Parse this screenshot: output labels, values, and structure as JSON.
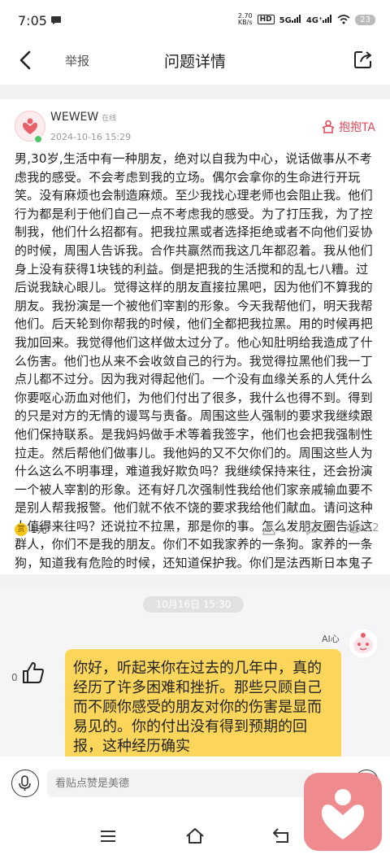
{
  "status": {
    "time": "7:05",
    "speed_value": "2.70",
    "speed_unit": "KB/s",
    "hd": "HD",
    "net1": "5G",
    "net2": "4G⁺",
    "battery": "23"
  },
  "nav": {
    "report": "举报",
    "title": "问题详情"
  },
  "post": {
    "username": "WEWEW",
    "online": "在线",
    "date": "2024-10-16 15:29",
    "hug_label": "抱抱TA",
    "body": "男,30岁,生活中有一种朋友，绝对以自我为中心，说话做事从不考虑我的感受。不会考虑到我的立场。偶尔会拿你的生命进行开玩笑。没有麻烦也会制造麻烦。至少我找心理老师也会阻止我。他们行为都是利于他们自己一点不考虑我的感受。为了打压我，为了控制我，他们什么招都有。把我拉黑或者选择拒绝或者不向他们妥协的时候，周围人告诉我。合作共赢然而我这几年都忍着。我从他们身上没有获得1块钱的利益。倒是把我的生活搅和的乱七八糟。过后说我缺心眼儿。觉得这样的朋友直接拉黑吧，因为他们不算我的朋友。我扮演是一个被他们宰割的形象。今天我帮他们，明天我帮他们。后天轮到你帮我的时候，他们全都把我拉黑。用的时候再把我加回来。我觉得他们这样做太过分了。他心知肚明给我造成了什么伤害。他们也从来不会收敛自己的行为。我觉得拉黑他们我一丁点儿都不过分。因为我对得起他们。一个没有血缘关系的人凭什么你要呕心沥血对他们，为他们付出了很多，我什么也得不到。得到的只是对方的无情的谩骂与责备。周围这些人强制的要求我继续跟他们保持联系。是我妈妈做手术等着我签字，他们也会把我强制性拉走。然后帮他们做事儿。我他妈的又不欠你们的。周围这些人为什么这么不明事理，难道我好欺负吗？我继续保持来往，还会扮演一个被人宰割的形象。还有好几次强制性我给他们家亲戚输血要不是别人帮我报警。他们就不依不饶的要求我给他们献血。请问这种人值得来往吗？还说拉不拉黑，那是你的事。怎么发朋友圈告诉这群人，你们不是我的朋友。你们不如我家养的一条狗。家养的一条狗，知道我有危险的时候，还知道保护我。你们是法西斯日本鬼子转世吗？",
    "reward_icon": "赏",
    "reward": "1元",
    "hugs": "1",
    "comments": "2",
    "views": "52"
  },
  "chat": {
    "timestamp": "10月16日 15:30",
    "ai_label": "AI心",
    "like_count": "0",
    "message": "你好，听起来你在过去的几年中，真的经历了许多困难和挫折。那些只顾自己而不顾你感受的朋友对你的伤害是显而易见的。你的付出没有得到预期的回报，这种经历确实"
  },
  "input": {
    "placeholder": "看贴点赞是美德"
  },
  "colors": {
    "accent": "#e04a5a",
    "bubble": "#fbd65a",
    "fab": "#ef8a8e"
  }
}
